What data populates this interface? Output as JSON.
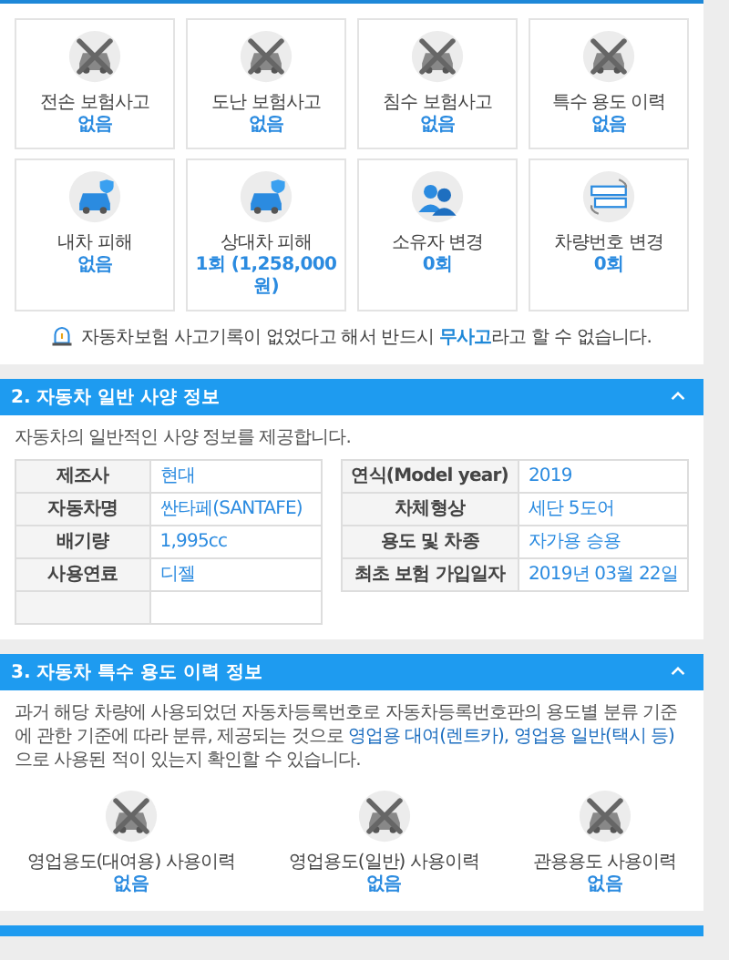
{
  "summary_cards": [
    {
      "label": "전손 보험사고",
      "value": "없음",
      "crossed": true
    },
    {
      "label": "도난 보험사고",
      "value": "없음",
      "crossed": true
    },
    {
      "label": "침수 보험사고",
      "value": "없음",
      "crossed": true
    },
    {
      "label": "특수 용도 이력",
      "value": "없음",
      "crossed": true
    },
    {
      "label": "내차 피해",
      "value": "없음",
      "crossed": false
    },
    {
      "label": "상대차 피해",
      "value": "1회 (1,258,000 원)",
      "crossed": false
    },
    {
      "label": "소유자 변경",
      "value": "0회",
      "crossed": false
    },
    {
      "label": "차량번호 변경",
      "value": "0회",
      "crossed": false
    }
  ],
  "notice": "자동차보험 사고기록이 없었다고 해서 반드시 **무사고**라고 할 수 없습니다.",
  "spec_section": {
    "title": "2. 자동차 일반 사양 정보",
    "expanded": true,
    "description": "자동차의 일반적인 사양 정보를 제공합니다.",
    "left_table": [
      {
        "label": "제조사",
        "value": "현대"
      },
      {
        "label": "자동차명",
        "value": "싼타페(SANTAFE)"
      },
      {
        "label": "배기량",
        "value": "1,995cc"
      },
      {
        "label": "사용연료",
        "value": "디젤"
      }
    ],
    "right_table": [
      {
        "label": "연식(Model year)",
        "value": "2019"
      },
      {
        "label": "차체형상",
        "value": "세단 5도어"
      },
      {
        "label": "용도 및 차종",
        "value": "자가용 승용"
      },
      {
        "label": "최초 보험 가입일자",
        "value": "2019년 03월 22일"
      }
    ]
  },
  "special_section": {
    "title": "3. 자동차 특수 용도 이력 정보",
    "expanded": true,
    "description": "과거 해당 차량에 사용되었던 자동차등록번호로 자동차등록번호판의 용도별 분류 기준에 관한 기준에 따라 분류, 제공되는 것으로 **영업용 대여(렌트카), 영업용 일반(택시 등)**으로 사용된 적이 있는지 확인할 수 있습니다.",
    "items": [
      {
        "label": "영업용도(대여용) 사용이력",
        "value": "없음",
        "crossed": true
      },
      {
        "label": "영업용도(일반) 사용이력",
        "value": "없음",
        "crossed": true
      },
      {
        "label": "관용용도 사용이력",
        "value": "없음",
        "crossed": true
      }
    ]
  }
}
